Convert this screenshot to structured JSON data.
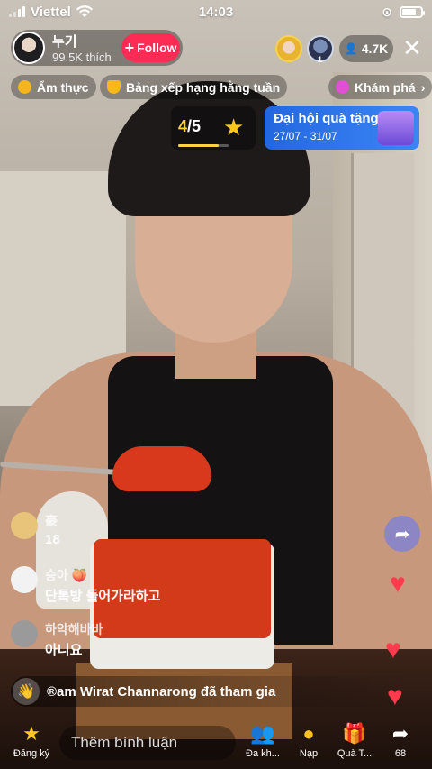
{
  "status_bar": {
    "carrier": "Viettel",
    "time": "14:03"
  },
  "host": {
    "name": "누기",
    "likes": "99.5K thích",
    "follow_label": "Follow"
  },
  "viewers": {
    "count": "4.7K",
    "top_viewer_rank": "1"
  },
  "tags": [
    {
      "label": "Ẩm thực"
    },
    {
      "label": "Bảng xếp hạng hằng tuần"
    },
    {
      "label": "Khám phá"
    }
  ],
  "rank_widget": {
    "current": "4",
    "total": "/5",
    "progress": 0.8
  },
  "event_banner": {
    "title": "Đại hội quà tặng",
    "date": "27/07 - 31/07"
  },
  "comments": [
    {
      "name": "豪",
      "text": "18"
    },
    {
      "name": "승아 🍑",
      "text": "단톡방 들어가라하고"
    },
    {
      "name": "하악해바바",
      "text": "아니요"
    }
  ],
  "join_notice": {
    "text": "®am Wirat Channarong đã tham gia"
  },
  "bottom_bar": {
    "subscribe_label": "Đăng ký",
    "comment_placeholder": "Thêm bình luận",
    "multi_guest_label": "Đa kh...",
    "recharge_label": "Nạp",
    "gift_label": "Quà T...",
    "share_count": "68"
  },
  "colors": {
    "follow": "#fe2c55",
    "event": "#2a73ea",
    "rank_accent": "#ffd33d",
    "heart": "#ff3b4e"
  }
}
